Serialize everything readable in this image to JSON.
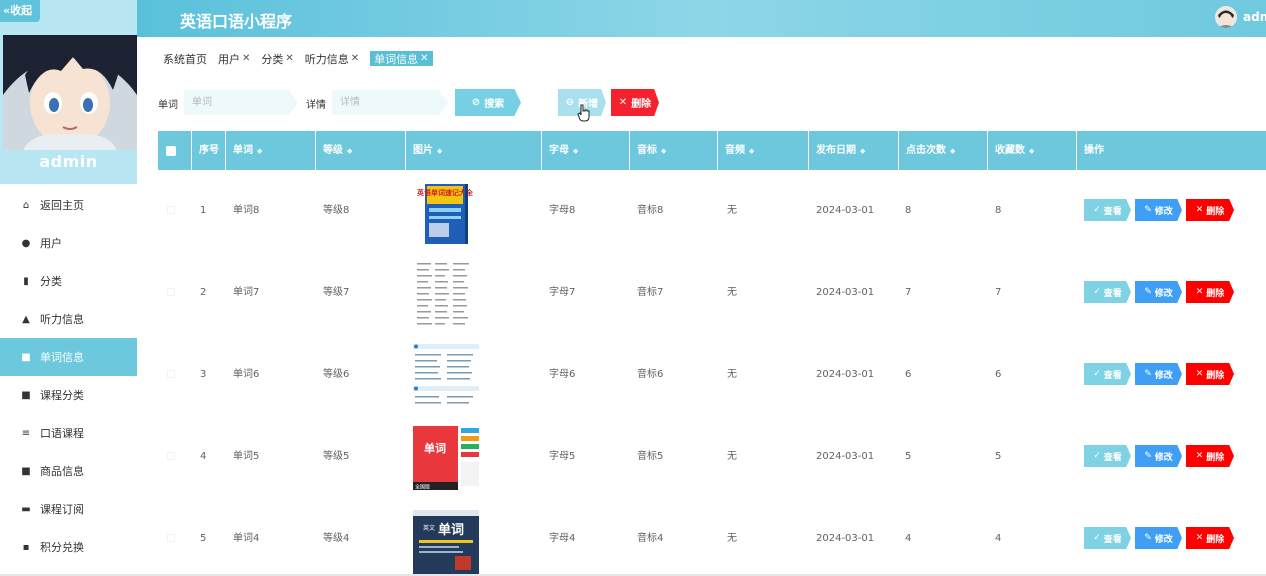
{
  "sidebar": {
    "collapse_label": "«收起",
    "username": "admin",
    "items": [
      {
        "label": "返回主页",
        "icon": "home-icon",
        "glyph": "⌂"
      },
      {
        "label": "用户",
        "icon": "location-pin-icon",
        "glyph": "●"
      },
      {
        "label": "分类",
        "icon": "clipboard-icon",
        "glyph": "▮"
      },
      {
        "label": "听力信息",
        "icon": "person-icon",
        "glyph": "▲"
      },
      {
        "label": "单词信息",
        "icon": "grid-icon",
        "glyph": "■"
      },
      {
        "label": "课程分类",
        "icon": "grid-icon",
        "glyph": "■"
      },
      {
        "label": "口语课程",
        "icon": "list-icon",
        "glyph": "≡"
      },
      {
        "label": "商品信息",
        "icon": "grid-icon",
        "glyph": "■"
      },
      {
        "label": "课程订阅",
        "icon": "printer-icon",
        "glyph": "▬"
      },
      {
        "label": "积分兑换",
        "icon": "chat-icon",
        "glyph": "▪"
      }
    ],
    "active_index": 4
  },
  "header": {
    "title": "英语口语小程序",
    "user": "adm"
  },
  "tabs": [
    {
      "label": "系统首页",
      "closable": false
    },
    {
      "label": "用户",
      "closable": true
    },
    {
      "label": "分类",
      "closable": true
    },
    {
      "label": "听力信息",
      "closable": true
    },
    {
      "label": "单词信息",
      "closable": true,
      "active": true
    }
  ],
  "search": {
    "word_label": "单词",
    "word_placeholder": "单词",
    "detail_label": "详情",
    "detail_placeholder": "详情",
    "search_button": "搜索",
    "add_button": "新增",
    "delete_button": "删除"
  },
  "table": {
    "headers": [
      "序号",
      "单词",
      "等级",
      "图片",
      "字母",
      "音标",
      "音频",
      "发布日期",
      "点击次数",
      "收藏数",
      "操作"
    ],
    "rows": [
      {
        "index": "1",
        "word": "单词8",
        "level": "等级8",
        "letter": "字母8",
        "phonetic": "音标8",
        "audio": "无",
        "date": "2024-03-01",
        "clicks": "8",
        "favorites": "8"
      },
      {
        "index": "2",
        "word": "单词7",
        "level": "等级7",
        "letter": "字母7",
        "phonetic": "音标7",
        "audio": "无",
        "date": "2024-03-01",
        "clicks": "7",
        "favorites": "7"
      },
      {
        "index": "3",
        "word": "单词6",
        "level": "等级6",
        "letter": "字母6",
        "phonetic": "音标6",
        "audio": "无",
        "date": "2024-03-01",
        "clicks": "6",
        "favorites": "6"
      },
      {
        "index": "4",
        "word": "单词5",
        "level": "等级5",
        "letter": "字母5",
        "phonetic": "音标5",
        "audio": "无",
        "date": "2024-03-01",
        "clicks": "5",
        "favorites": "5"
      },
      {
        "index": "5",
        "word": "单词4",
        "level": "等级4",
        "letter": "字母4",
        "phonetic": "音标4",
        "audio": "无",
        "date": "2024-03-01",
        "clicks": "4",
        "favorites": "4"
      }
    ],
    "actions": {
      "view": "查看",
      "edit": "修改",
      "delete": "删除"
    }
  },
  "thumbnails": {
    "book1_title": "英语单词速记大全",
    "book4_title": "单词",
    "book4_sub": "全国版",
    "book5_title": "单词",
    "book5_sub": "英文"
  },
  "colors": {
    "accent": "#6ec8dd",
    "danger": "#ff0000",
    "edit": "#3f9ff5"
  }
}
